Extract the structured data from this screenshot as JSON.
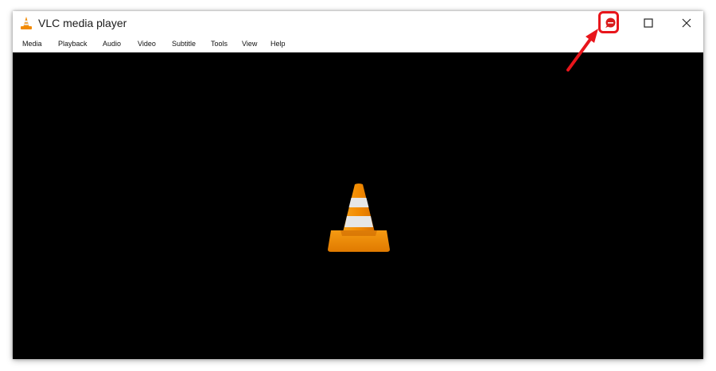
{
  "window": {
    "title": "VLC media player",
    "app_icon": "vlc-cone-icon",
    "controls": {
      "minimize_icon": "minimize-icon",
      "maximize_icon": "maximize-icon",
      "close_icon": "close-icon"
    }
  },
  "menu": {
    "items": [
      "Media",
      "Playback",
      "Audio",
      "Video",
      "Subtitle",
      "Tools",
      "View",
      "Help"
    ]
  },
  "video": {
    "placeholder_icon": "vlc-cone-icon"
  },
  "annotation": {
    "color": "#e8151b",
    "target": "minimize-button"
  },
  "colors": {
    "cone_orange": "#f28a00",
    "cone_stripe": "#e6e6e6",
    "video_background": "#000000"
  }
}
